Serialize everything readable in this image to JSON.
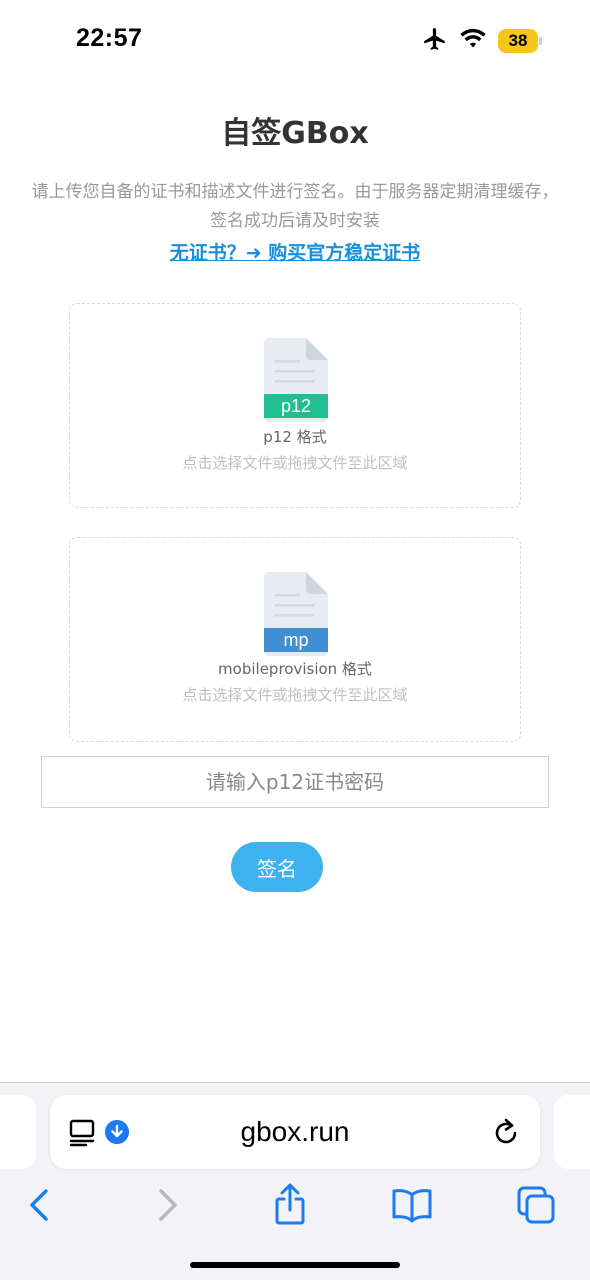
{
  "status_bar": {
    "time": "22:57",
    "battery": "38",
    "icons": [
      "airplane-icon",
      "wifi-icon",
      "battery-icon"
    ]
  },
  "page": {
    "title": "自签GBox",
    "description": "请上传您自备的证书和描述文件进行签名。由于服务器定期清理缓存，签名成功后请及时安装",
    "cert_link": "无证书？➜ 购买官方稳定证书"
  },
  "uploads": [
    {
      "badge": "p12",
      "badge_color": "#1fbf8f",
      "format": "p12 格式",
      "hint": "点击选择文件或拖拽文件至此区域"
    },
    {
      "badge": "mp",
      "badge_color": "#3f8fd2",
      "format": "mobileprovision 格式",
      "hint": "点击选择文件或拖拽文件至此区域"
    }
  ],
  "password": {
    "placeholder": "请输入p12证书密码",
    "value": ""
  },
  "sign_button": "签名",
  "browser": {
    "url": "gbox.run",
    "accent": "#1a7cf0"
  }
}
